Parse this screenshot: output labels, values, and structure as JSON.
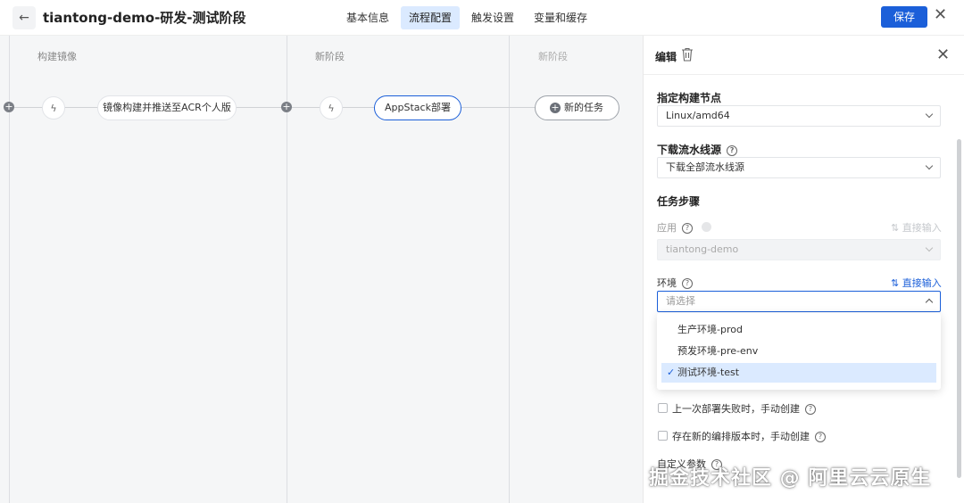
{
  "header": {
    "title": "tiantong-demo-研发-测试阶段",
    "tabs": [
      {
        "label": "基本信息"
      },
      {
        "label": "流程配置"
      },
      {
        "label": "触发设置"
      },
      {
        "label": "变量和缓存"
      }
    ],
    "active_tab": "流程配置",
    "save_label": "保存"
  },
  "canvas": {
    "stages": [
      {
        "title": "构建镜像",
        "job": "镜像构建并推送至ACR个人版"
      },
      {
        "title": "新阶段",
        "job": "AppStack部署"
      },
      {
        "title": "新阶段",
        "job": "新的任务"
      }
    ]
  },
  "panel": {
    "title": "编辑",
    "build_node": {
      "label": "指定构建节点",
      "value": "Linux/amd64"
    },
    "download_source": {
      "label": "下载流水线源",
      "value": "下载全部流水线源"
    },
    "steps_label": "任务步骤",
    "app": {
      "label": "应用",
      "value": "tiantong-demo",
      "direct": "直接输入"
    },
    "env": {
      "label": "环境",
      "placeholder": "请选择",
      "direct": "直接输入",
      "options": [
        "生产环境-prod",
        "预发环境-pre-env",
        "测试环境-test"
      ],
      "selected": "测试环境-test"
    },
    "checkboxes": [
      {
        "label": "上一次部署失败时，手动创建",
        "checked": false
      },
      {
        "label": "存在新的编排版本时，手动创建",
        "checked": false
      }
    ],
    "custom_params_label": "自定义参数"
  },
  "watermark": "掘金技术社区 @ 阿里云云原生"
}
